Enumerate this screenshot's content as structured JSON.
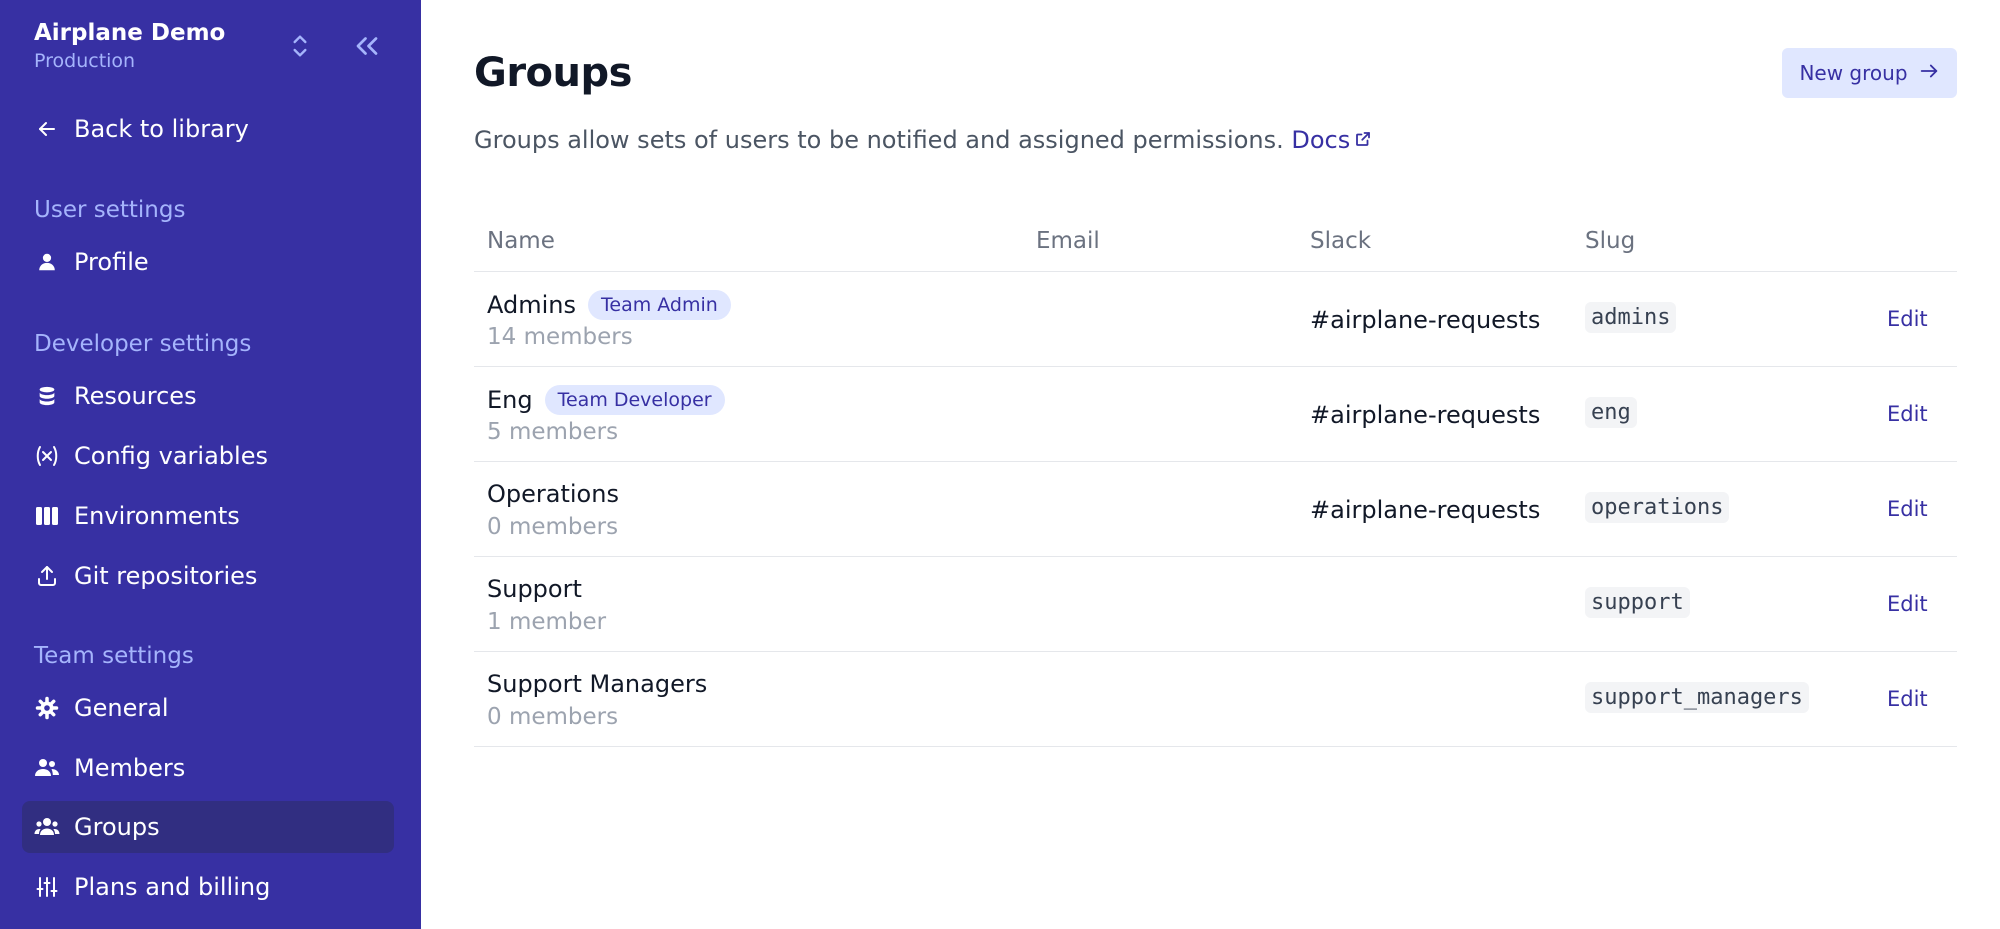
{
  "workspace": {
    "name": "Airplane Demo",
    "environment": "Production"
  },
  "sidebar": {
    "back_label": "Back to library",
    "sections": [
      {
        "title": "User settings",
        "items": [
          {
            "label": "Profile",
            "icon": "person-icon"
          }
        ]
      },
      {
        "title": "Developer settings",
        "items": [
          {
            "label": "Resources",
            "icon": "database-icon"
          },
          {
            "label": "Config variables",
            "icon": "variable-icon"
          },
          {
            "label": "Environments",
            "icon": "columns-icon"
          },
          {
            "label": "Git repositories",
            "icon": "upload-icon"
          }
        ]
      },
      {
        "title": "Team settings",
        "items": [
          {
            "label": "General",
            "icon": "gear-icon"
          },
          {
            "label": "Members",
            "icon": "users-icon"
          },
          {
            "label": "Groups",
            "icon": "user-group-icon",
            "active": true
          },
          {
            "label": "Plans and billing",
            "icon": "sliders-icon"
          }
        ]
      }
    ]
  },
  "page": {
    "title": "Groups",
    "description": "Groups allow sets of users to be notified and assigned permissions.",
    "docs_label": "Docs",
    "new_button_label": "New group"
  },
  "table": {
    "columns": [
      "Name",
      "Email",
      "Slack",
      "Slug"
    ],
    "edit_label": "Edit",
    "rows": [
      {
        "name": "Admins",
        "badge": "Team Admin",
        "members": "14 members",
        "email": "",
        "slack": "#airplane-requests",
        "slug": "admins"
      },
      {
        "name": "Eng",
        "badge": "Team Developer",
        "members": "5 members",
        "email": "",
        "slack": "#airplane-requests",
        "slug": "eng"
      },
      {
        "name": "Operations",
        "badge": "",
        "members": "0 members",
        "email": "",
        "slack": "#airplane-requests",
        "slug": "operations"
      },
      {
        "name": "Support",
        "badge": "",
        "members": "1 member",
        "email": "",
        "slack": "",
        "slug": "support"
      },
      {
        "name": "Support Managers",
        "badge": "",
        "members": "0 members",
        "email": "",
        "slack": "",
        "slug": "support_managers"
      }
    ]
  },
  "colors": {
    "sidebar_bg": "#3730a3",
    "sidebar_active_bg": "#312e81",
    "section_title": "#a5b4fc",
    "accent": "#3730a3",
    "badge_bg": "#e0e7ff"
  }
}
